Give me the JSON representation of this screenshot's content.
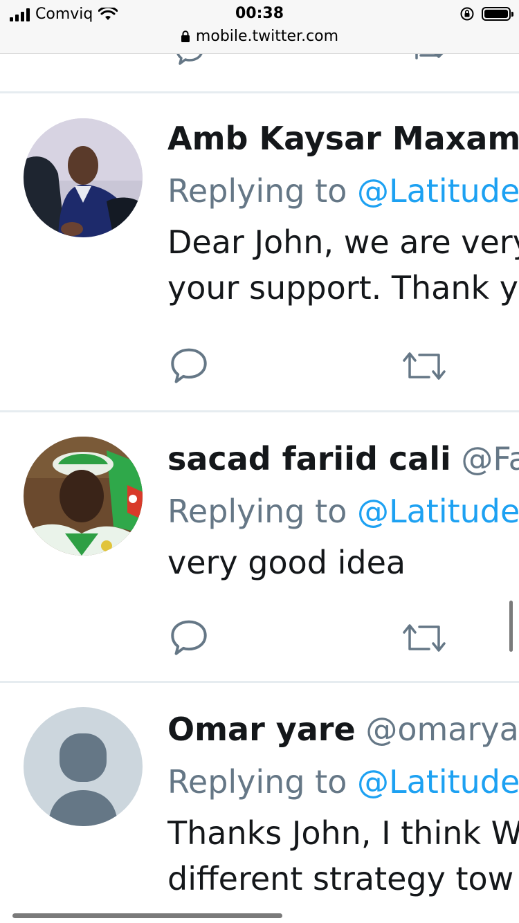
{
  "status_bar": {
    "carrier": "Comviq",
    "time": "00:38",
    "url": "mobile.twitter.com",
    "icons": [
      "signal-icon",
      "wifi-icon",
      "rotation-lock-icon",
      "battery-icon",
      "lock-icon"
    ]
  },
  "tweets": [
    {
      "name": "Amb Kaysar Maxamed",
      "handle": "",
      "replying_label": "Replying to",
      "mention": "@Latitude",
      "text_lines": [
        "Dear John, we are very",
        "your support. Thank you"
      ],
      "avatar": "photo"
    },
    {
      "name": "sacad fariid cali",
      "handle": "@Fa",
      "replying_label": "Replying to",
      "mention": "@Latitude",
      "text_lines": [
        "very good idea"
      ],
      "avatar": "photo"
    },
    {
      "name": "Omar yare",
      "handle": "@omarya",
      "replying_label": "Replying to",
      "mention": "@Latitude",
      "text_lines": [
        "Thanks John, I think W",
        "different strategy tow"
      ],
      "avatar": "default-profile"
    }
  ],
  "colors": {
    "link": "#1da1f2",
    "muted": "#657786",
    "text": "#14171a",
    "separator": "#e6ecf0",
    "action_icon": "#657786"
  }
}
